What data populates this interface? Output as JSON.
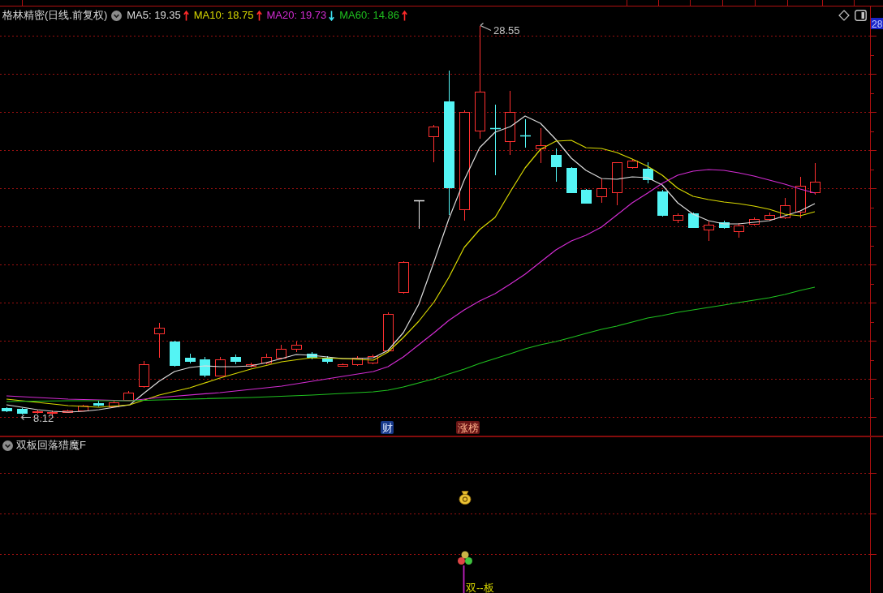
{
  "header": {
    "title": "格林精密(日线.前复权)",
    "indicators": [
      {
        "label": "MA5: 19.35",
        "color": "#dcdcdc",
        "rising": true
      },
      {
        "label": "MA10: 18.75",
        "color": "#d8d800",
        "rising": true
      },
      {
        "label": "MA20: 19.73",
        "color": "#d22cd2",
        "rising": false
      },
      {
        "label": "MA60: 14.86",
        "color": "#1fc01f",
        "rising": true
      }
    ]
  },
  "main_chart": {
    "price_tag": "28",
    "high_label": "28.55",
    "low_label": "8.12",
    "events": [
      {
        "label": "财",
        "kind": "finance"
      },
      {
        "label": "涨榜",
        "kind": "limit_up"
      }
    ]
  },
  "indicator_panel": {
    "title": "双板回落猎魔F",
    "signal_label": "双--板"
  }
}
